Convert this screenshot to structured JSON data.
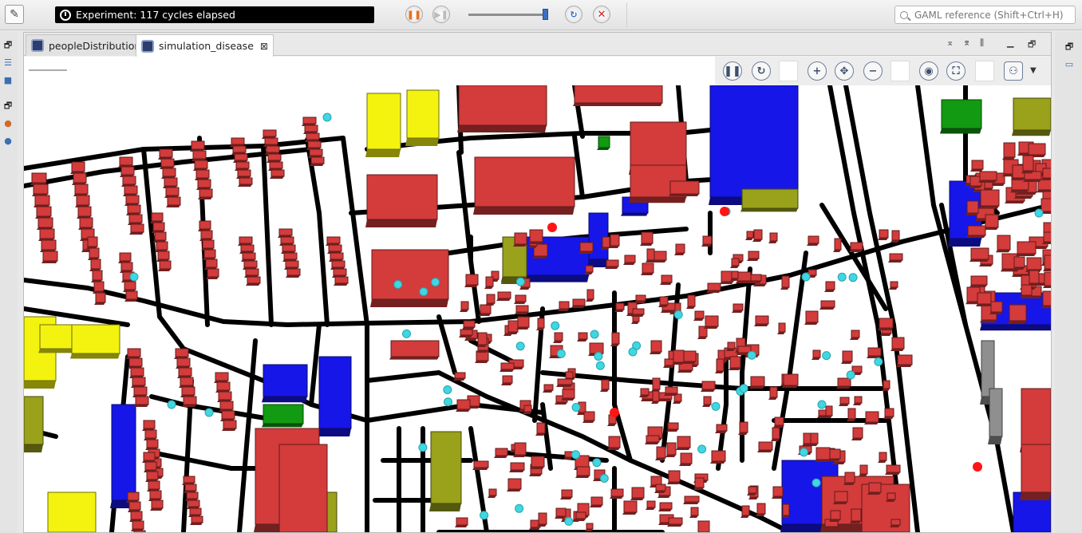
{
  "toolbar": {
    "status_text": "Experiment: 117 cycles elapsed",
    "search_placeholder": "GAML reference (Shift+Ctrl+H)",
    "icons": {
      "edit": "edit-icon",
      "pause": "pause-icon",
      "step": "step-icon",
      "reload": "reload-icon",
      "close": "close-icon"
    }
  },
  "tabs": [
    {
      "label": "peopleDistribution",
      "active": false
    },
    {
      "label": "simulation_disease",
      "active": true,
      "close_glyph": "⊠"
    }
  ],
  "view_toolbar": {
    "buttons": [
      "pause",
      "sync",
      "zoom-in",
      "zoom-fit",
      "zoom-out",
      "snapshot",
      "fullscreen",
      "layers"
    ]
  },
  "colors": {
    "building": "#d43b3b",
    "school": "#1616e8",
    "olive": "#9aa11a",
    "yellow": "#f3f30f",
    "green": "#129a12",
    "gray": "#8f8f8f",
    "road": "#000000",
    "people": "#3fd7e1",
    "infected": "#ff1515"
  }
}
